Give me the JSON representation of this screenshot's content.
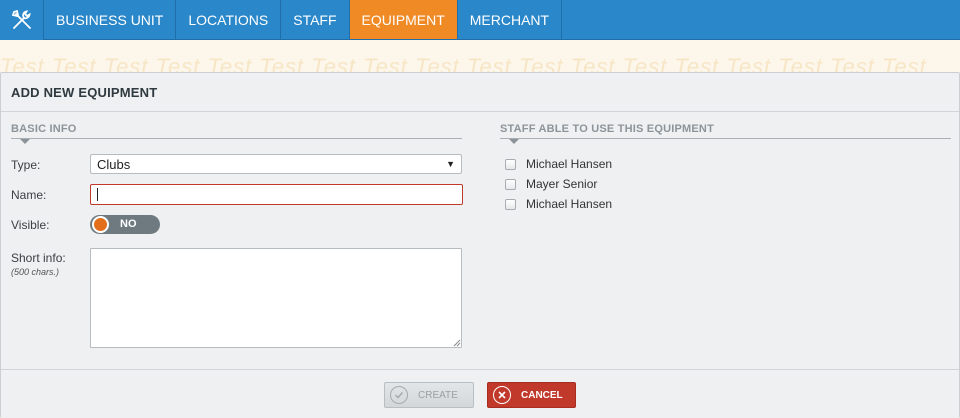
{
  "nav": {
    "items": [
      {
        "label": "BUSINESS UNIT",
        "active": false
      },
      {
        "label": "LOCATIONS",
        "active": false
      },
      {
        "label": "STAFF",
        "active": false
      },
      {
        "label": "EQUIPMENT",
        "active": true
      },
      {
        "label": "MERCHANT",
        "active": false
      }
    ],
    "logo_icon": "tools-icon"
  },
  "watermark": {
    "text": "Test Test Test Test Test Test Test Test Test Test Test Test Test Test Test Test Test Test"
  },
  "panel": {
    "title": "ADD NEW EQUIPMENT"
  },
  "basic_info": {
    "section_title": "BASIC INFO",
    "type_label": "Type:",
    "type_value": "Clubs",
    "name_label": "Name:",
    "name_value": "",
    "visible_label": "Visible:",
    "visible_value": "NO",
    "short_info_label": "Short info:",
    "short_info_hint": "(500 chars.)",
    "short_info_value": ""
  },
  "staff": {
    "section_title": "STAFF ABLE TO USE THIS EQUIPMENT",
    "members": [
      "Michael Hansen",
      "Mayer Senior",
      "Michael Hansen"
    ]
  },
  "footer": {
    "create_label": "CREATE",
    "cancel_label": "CANCEL"
  },
  "colors": {
    "nav_bg": "#2a87c9",
    "nav_active": "#ef8a25",
    "error_border": "#c0392b",
    "cancel_bg": "#c0392b",
    "toggle_bg": "#6f7a80",
    "toggle_knob": "#e36e1c"
  }
}
